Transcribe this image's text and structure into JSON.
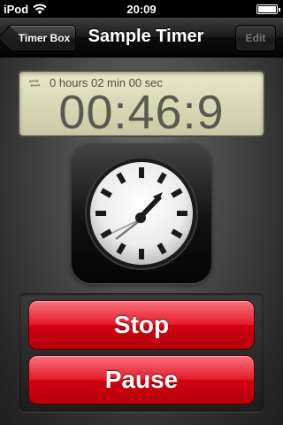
{
  "status_bar": {
    "carrier": "iPod",
    "time": "20:09",
    "wifi_icon": "wifi-icon",
    "battery_icon": "battery-icon",
    "battery_level": 1.0
  },
  "nav": {
    "back_label": "Timer Box",
    "title": "Sample Timer",
    "edit_label": "Edit",
    "edit_enabled": false
  },
  "timer": {
    "repeat_icon": "repeat-icon",
    "duration_text": "0 hours 02 min 00 sec",
    "display": "00:46:9"
  },
  "dial": {
    "icon": "stopwatch-dial-icon"
  },
  "buttons": {
    "stop_label": "Stop",
    "pause_label": "Pause"
  },
  "colors": {
    "accent_red": "#d00010",
    "lcd_background": "#d7d6b3",
    "lcd_text": "#5a5a50"
  }
}
